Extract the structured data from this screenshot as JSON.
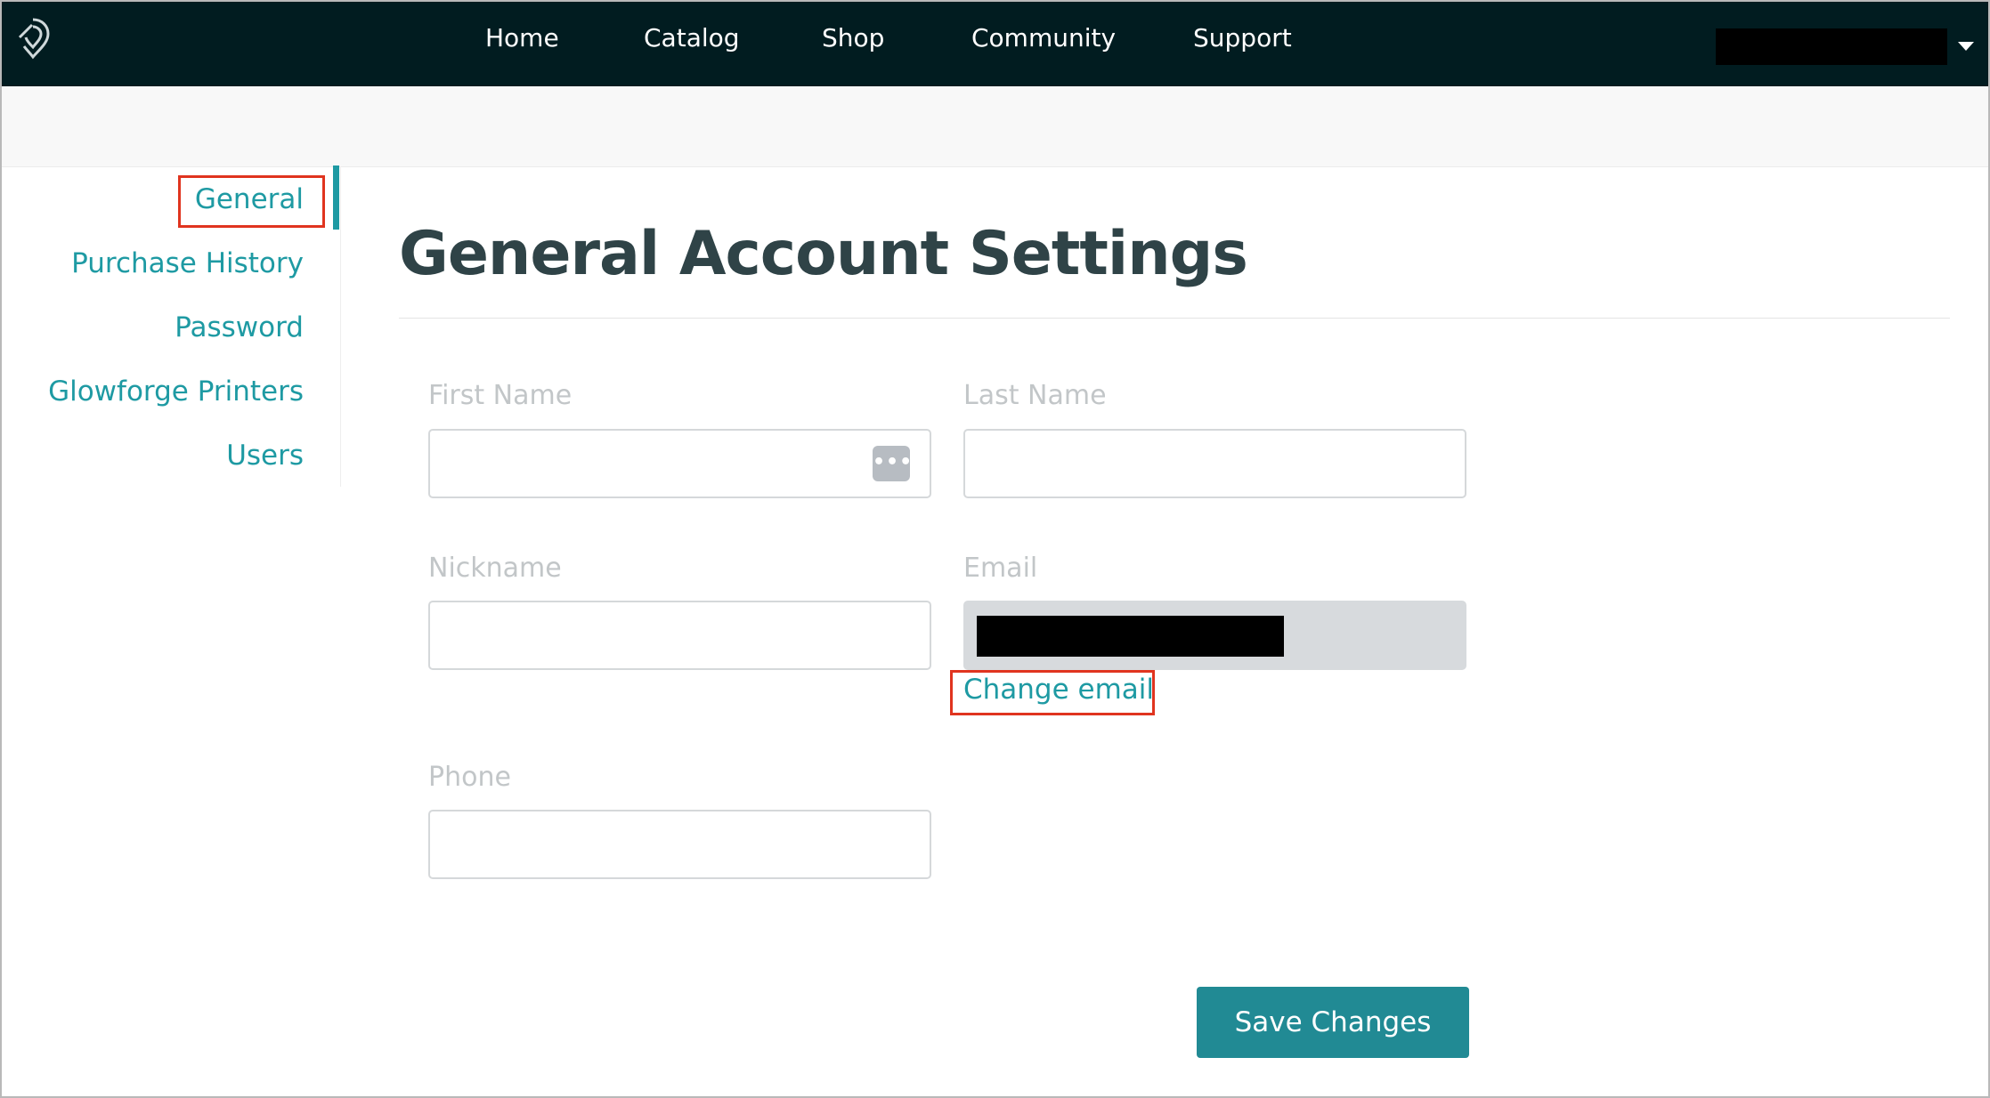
{
  "nav": {
    "items": [
      {
        "label": "Home"
      },
      {
        "label": "Catalog"
      },
      {
        "label": "Shop"
      },
      {
        "label": "Community"
      },
      {
        "label": "Support"
      }
    ]
  },
  "sidebar": {
    "items": [
      {
        "label": "General",
        "active": true
      },
      {
        "label": "Purchase History"
      },
      {
        "label": "Password"
      },
      {
        "label": "Glowforge Printers"
      },
      {
        "label": "Users"
      }
    ]
  },
  "main": {
    "title": "General Account Settings",
    "fields": {
      "first_name": {
        "label": "First Name",
        "value": ""
      },
      "last_name": {
        "label": "Last Name",
        "value": ""
      },
      "nickname": {
        "label": "Nickname",
        "value": ""
      },
      "email": {
        "label": "Email",
        "value": ""
      },
      "phone": {
        "label": "Phone",
        "value": ""
      }
    },
    "change_email_label": "Change email",
    "save_label": "Save Changes",
    "dots_icon_glyph": "•••|"
  },
  "colors": {
    "topbar": "#011c20",
    "accent": "#1e9aa3",
    "button": "#218a94",
    "highlight": "#e0341f"
  }
}
